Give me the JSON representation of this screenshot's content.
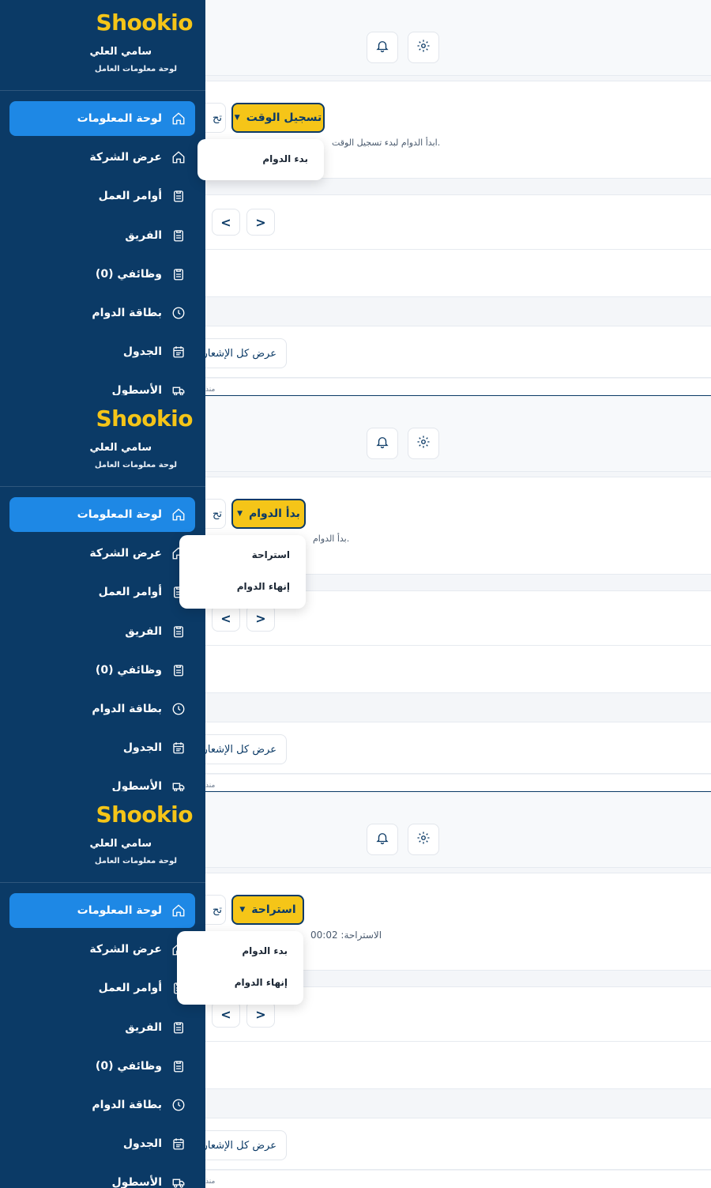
{
  "sidebar": {
    "brand": "Shookio",
    "user_name": "سامي العلي",
    "user_subtitle": "لوحة معلومات العامل",
    "items": [
      {
        "label": "لوحة المعلومات",
        "icon": "home-icon"
      },
      {
        "label": "عرض الشركة",
        "icon": "home-icon"
      },
      {
        "label": "أوامر العمل",
        "icon": "clipboard-icon"
      },
      {
        "label": "الفريق",
        "icon": "clipboard-icon"
      },
      {
        "label": "وظائفي (0)",
        "icon": "clipboard-icon"
      },
      {
        "label": "بطاقة الدوام",
        "icon": "clock-icon"
      },
      {
        "label": "الجدول",
        "icon": "calendar-icon"
      },
      {
        "label": "الأسطول",
        "icon": "truck-icon"
      }
    ]
  },
  "main": {
    "tab_ghost": "تح",
    "view_all": "عرض كل الإشعارات",
    "tiny_text": "منذ",
    "prev": "<",
    "next": ">"
  },
  "frames": [
    {
      "button_label": "تسجيل الوقت",
      "hint": "ابدأ الدوام لبدء تسجيل الوقت.",
      "dropdown_items": [
        "بدء الدوام"
      ]
    },
    {
      "button_label": "بدأ الدوام",
      "hint": "بدأ الدوام.",
      "dropdown_items": [
        "استراحة",
        "إنهاء الدوام"
      ]
    },
    {
      "button_label": "استراحة",
      "hint": "الاستراحة: 00:02",
      "dropdown_items": [
        "بدء الدوام",
        "إنهاء الدوام"
      ]
    }
  ],
  "colors": {
    "sidebar_bg": "#0b3a66",
    "accent_blue": "#1e88e5",
    "brand_yellow": "#f5c518"
  }
}
